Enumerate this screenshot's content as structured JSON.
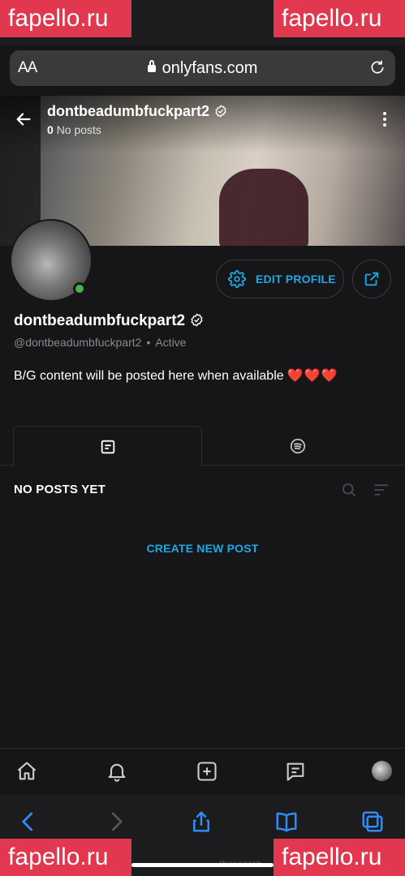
{
  "browser": {
    "aa_label": "AA",
    "url": "onlyfans.com"
  },
  "cover": {
    "name": "dontbeadumbfuckpart2",
    "post_count": "0",
    "posts_label": "No posts"
  },
  "profile": {
    "name": "dontbeadumbfuckpart2",
    "handle": "@dontbeadumbfuckpart2",
    "separator": "•",
    "status": "Active",
    "bio": "B/G content will be posted here when available",
    "bio_emoji": "❤️❤️❤️",
    "edit_label": "EDIT PROFILE",
    "online_color": "#4caf50"
  },
  "content": {
    "no_posts": "NO POSTS YET",
    "create_post": "CREATE NEW POST"
  },
  "colors": {
    "accent": "#1fa8e4",
    "background": "#161618"
  },
  "watermark": {
    "text": "fapello.ru",
    "color": "#e1384f"
  },
  "bottom_caption": "thesearch"
}
